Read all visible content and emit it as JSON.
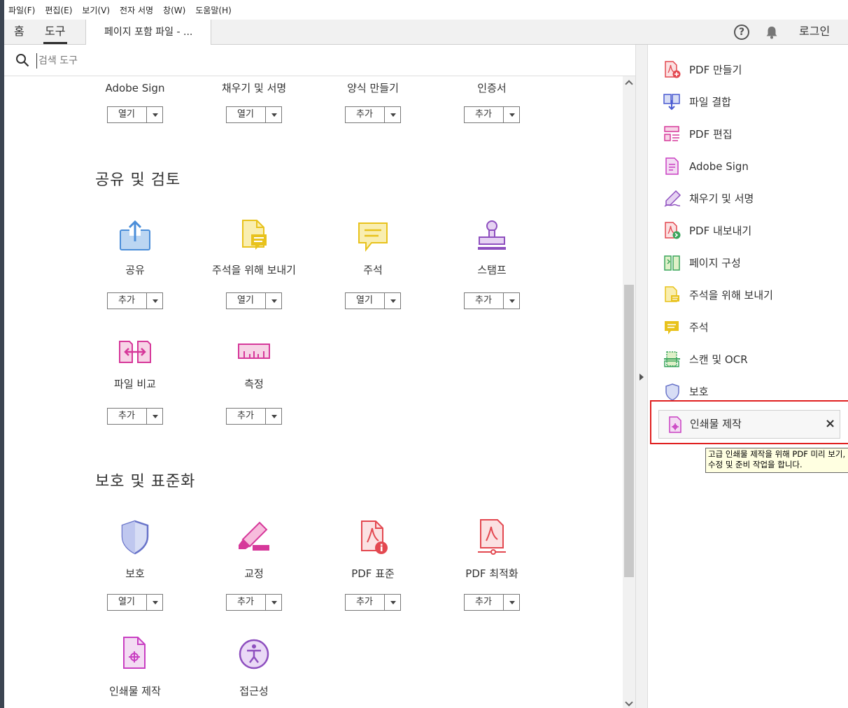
{
  "menubar": [
    "파일(F)",
    "편집(E)",
    "보기(V)",
    "전자 서명",
    "창(W)",
    "도움말(H)"
  ],
  "tabs": {
    "home": "홈",
    "tools": "도구",
    "document": "페이지 포함 파일 - ..."
  },
  "header": {
    "login": "로그인",
    "help": "?"
  },
  "search": {
    "placeholder": "검색 도구"
  },
  "sections": {
    "share_review": "공유 및 검토",
    "protect_standardize": "보호 및 표준화"
  },
  "tools": {
    "adobe_sign": {
      "label": "Adobe Sign",
      "button": "열기"
    },
    "fill_sign": {
      "label": "채우기 및 서명",
      "button": "열기"
    },
    "prepare_form": {
      "label": "양식 만들기",
      "button": "추가"
    },
    "certificates": {
      "label": "인증서",
      "button": "추가"
    },
    "share": {
      "label": "공유",
      "button": "추가"
    },
    "send_comments": {
      "label": "주석을 위해 보내기",
      "button": "열기"
    },
    "comment": {
      "label": "주석",
      "button": "열기"
    },
    "stamp": {
      "label": "스탬프",
      "button": "추가"
    },
    "compare": {
      "label": "파일 비교",
      "button": "추가"
    },
    "measure": {
      "label": "측정",
      "button": "추가"
    },
    "protect": {
      "label": "보호",
      "button": "열기"
    },
    "redact": {
      "label": "교정",
      "button": "추가"
    },
    "pdf_standards": {
      "label": "PDF 표준",
      "button": "추가"
    },
    "optimize": {
      "label": "PDF 최적화",
      "button": "추가"
    },
    "print_production": {
      "label": "인쇄물 제작"
    },
    "accessibility": {
      "label": "접근성"
    }
  },
  "right_panel": {
    "items": [
      {
        "label": "PDF 만들기"
      },
      {
        "label": "파일 결합"
      },
      {
        "label": "PDF 편집"
      },
      {
        "label": "Adobe Sign"
      },
      {
        "label": "채우기 및 서명"
      },
      {
        "label": "PDF 내보내기"
      },
      {
        "label": "페이지 구성"
      },
      {
        "label": "주석을 위해 보내기"
      },
      {
        "label": "주석"
      },
      {
        "label": "스캔 및 OCR"
      },
      {
        "label": "보호"
      }
    ],
    "highlighted": {
      "label": "인쇄물 제작",
      "close": "×"
    },
    "tooltip": {
      "line1": "고급 인쇄물 제작을 위해 PDF 미리 보기,",
      "line2": "수정 및 준비 작업을 합니다."
    }
  },
  "colors": {
    "red_tool": "#e34850",
    "purple_tool": "#b36fd6",
    "blue_tool": "#4b8ed9",
    "yellow_tool": "#e8c21c",
    "pink_tool": "#d6389a",
    "green_tool": "#3aa55c",
    "highlight_border": "#e02020"
  }
}
